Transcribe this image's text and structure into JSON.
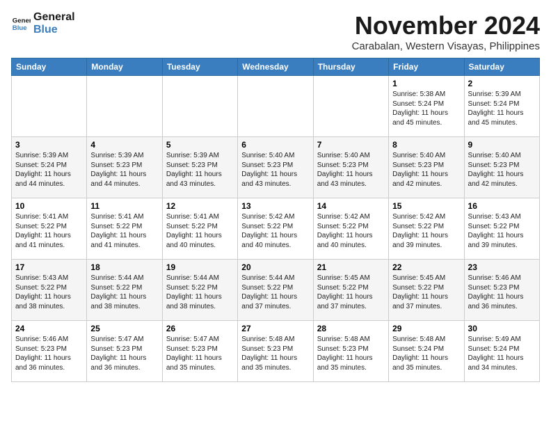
{
  "logo": {
    "line1": "General",
    "line2": "Blue"
  },
  "title": "November 2024",
  "location": "Carabalan, Western Visayas, Philippines",
  "days_of_week": [
    "Sunday",
    "Monday",
    "Tuesday",
    "Wednesday",
    "Thursday",
    "Friday",
    "Saturday"
  ],
  "weeks": [
    [
      {
        "day": "",
        "info": ""
      },
      {
        "day": "",
        "info": ""
      },
      {
        "day": "",
        "info": ""
      },
      {
        "day": "",
        "info": ""
      },
      {
        "day": "",
        "info": ""
      },
      {
        "day": "1",
        "info": "Sunrise: 5:38 AM\nSunset: 5:24 PM\nDaylight: 11 hours and 45 minutes."
      },
      {
        "day": "2",
        "info": "Sunrise: 5:39 AM\nSunset: 5:24 PM\nDaylight: 11 hours and 45 minutes."
      }
    ],
    [
      {
        "day": "3",
        "info": "Sunrise: 5:39 AM\nSunset: 5:24 PM\nDaylight: 11 hours and 44 minutes."
      },
      {
        "day": "4",
        "info": "Sunrise: 5:39 AM\nSunset: 5:23 PM\nDaylight: 11 hours and 44 minutes."
      },
      {
        "day": "5",
        "info": "Sunrise: 5:39 AM\nSunset: 5:23 PM\nDaylight: 11 hours and 43 minutes."
      },
      {
        "day": "6",
        "info": "Sunrise: 5:40 AM\nSunset: 5:23 PM\nDaylight: 11 hours and 43 minutes."
      },
      {
        "day": "7",
        "info": "Sunrise: 5:40 AM\nSunset: 5:23 PM\nDaylight: 11 hours and 43 minutes."
      },
      {
        "day": "8",
        "info": "Sunrise: 5:40 AM\nSunset: 5:23 PM\nDaylight: 11 hours and 42 minutes."
      },
      {
        "day": "9",
        "info": "Sunrise: 5:40 AM\nSunset: 5:23 PM\nDaylight: 11 hours and 42 minutes."
      }
    ],
    [
      {
        "day": "10",
        "info": "Sunrise: 5:41 AM\nSunset: 5:22 PM\nDaylight: 11 hours and 41 minutes."
      },
      {
        "day": "11",
        "info": "Sunrise: 5:41 AM\nSunset: 5:22 PM\nDaylight: 11 hours and 41 minutes."
      },
      {
        "day": "12",
        "info": "Sunrise: 5:41 AM\nSunset: 5:22 PM\nDaylight: 11 hours and 40 minutes."
      },
      {
        "day": "13",
        "info": "Sunrise: 5:42 AM\nSunset: 5:22 PM\nDaylight: 11 hours and 40 minutes."
      },
      {
        "day": "14",
        "info": "Sunrise: 5:42 AM\nSunset: 5:22 PM\nDaylight: 11 hours and 40 minutes."
      },
      {
        "day": "15",
        "info": "Sunrise: 5:42 AM\nSunset: 5:22 PM\nDaylight: 11 hours and 39 minutes."
      },
      {
        "day": "16",
        "info": "Sunrise: 5:43 AM\nSunset: 5:22 PM\nDaylight: 11 hours and 39 minutes."
      }
    ],
    [
      {
        "day": "17",
        "info": "Sunrise: 5:43 AM\nSunset: 5:22 PM\nDaylight: 11 hours and 38 minutes."
      },
      {
        "day": "18",
        "info": "Sunrise: 5:44 AM\nSunset: 5:22 PM\nDaylight: 11 hours and 38 minutes."
      },
      {
        "day": "19",
        "info": "Sunrise: 5:44 AM\nSunset: 5:22 PM\nDaylight: 11 hours and 38 minutes."
      },
      {
        "day": "20",
        "info": "Sunrise: 5:44 AM\nSunset: 5:22 PM\nDaylight: 11 hours and 37 minutes."
      },
      {
        "day": "21",
        "info": "Sunrise: 5:45 AM\nSunset: 5:22 PM\nDaylight: 11 hours and 37 minutes."
      },
      {
        "day": "22",
        "info": "Sunrise: 5:45 AM\nSunset: 5:22 PM\nDaylight: 11 hours and 37 minutes."
      },
      {
        "day": "23",
        "info": "Sunrise: 5:46 AM\nSunset: 5:23 PM\nDaylight: 11 hours and 36 minutes."
      }
    ],
    [
      {
        "day": "24",
        "info": "Sunrise: 5:46 AM\nSunset: 5:23 PM\nDaylight: 11 hours and 36 minutes."
      },
      {
        "day": "25",
        "info": "Sunrise: 5:47 AM\nSunset: 5:23 PM\nDaylight: 11 hours and 36 minutes."
      },
      {
        "day": "26",
        "info": "Sunrise: 5:47 AM\nSunset: 5:23 PM\nDaylight: 11 hours and 35 minutes."
      },
      {
        "day": "27",
        "info": "Sunrise: 5:48 AM\nSunset: 5:23 PM\nDaylight: 11 hours and 35 minutes."
      },
      {
        "day": "28",
        "info": "Sunrise: 5:48 AM\nSunset: 5:23 PM\nDaylight: 11 hours and 35 minutes."
      },
      {
        "day": "29",
        "info": "Sunrise: 5:48 AM\nSunset: 5:24 PM\nDaylight: 11 hours and 35 minutes."
      },
      {
        "day": "30",
        "info": "Sunrise: 5:49 AM\nSunset: 5:24 PM\nDaylight: 11 hours and 34 minutes."
      }
    ]
  ]
}
